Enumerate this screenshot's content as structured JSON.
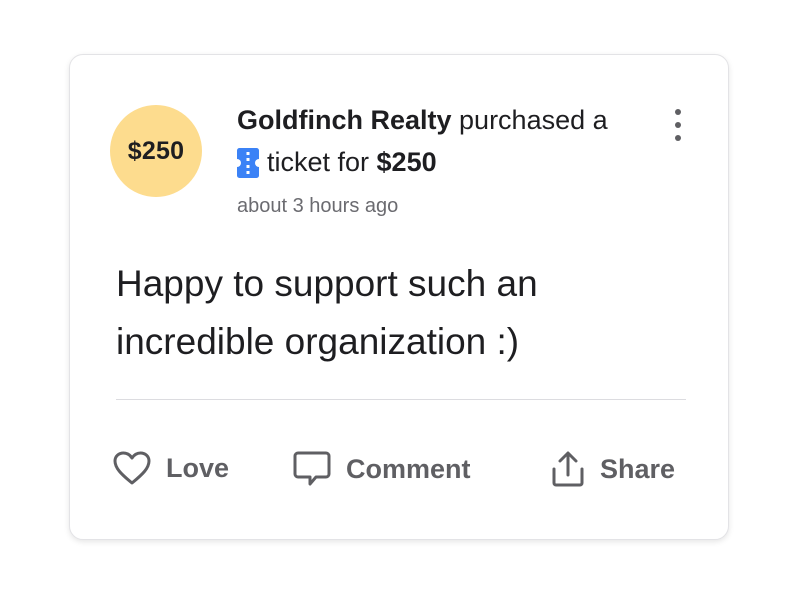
{
  "post": {
    "avatar_text": "$250",
    "actor": "Goldfinch Realty",
    "verb_text": " purchased a ",
    "ticket_text": "ticket for ",
    "amount": "$250",
    "timestamp": "about 3 hours ago",
    "message_line1": "Happy to support such an",
    "message_line2": "incredible organization :)"
  },
  "actions": {
    "love_label": "Love",
    "comment_label": "Comment",
    "share_label": "Share"
  },
  "icons": {
    "ticket": "ticket-icon",
    "menu": "more-vertical-icon",
    "love": "heart-icon",
    "comment": "comment-icon",
    "share": "share-icon"
  },
  "colors": {
    "avatar_bg": "#fddc8e",
    "ticket_icon": "#3b82f6",
    "text_primary": "#1e1e21",
    "text_secondary": "#6b6b70",
    "action_text": "#5f5f63"
  }
}
